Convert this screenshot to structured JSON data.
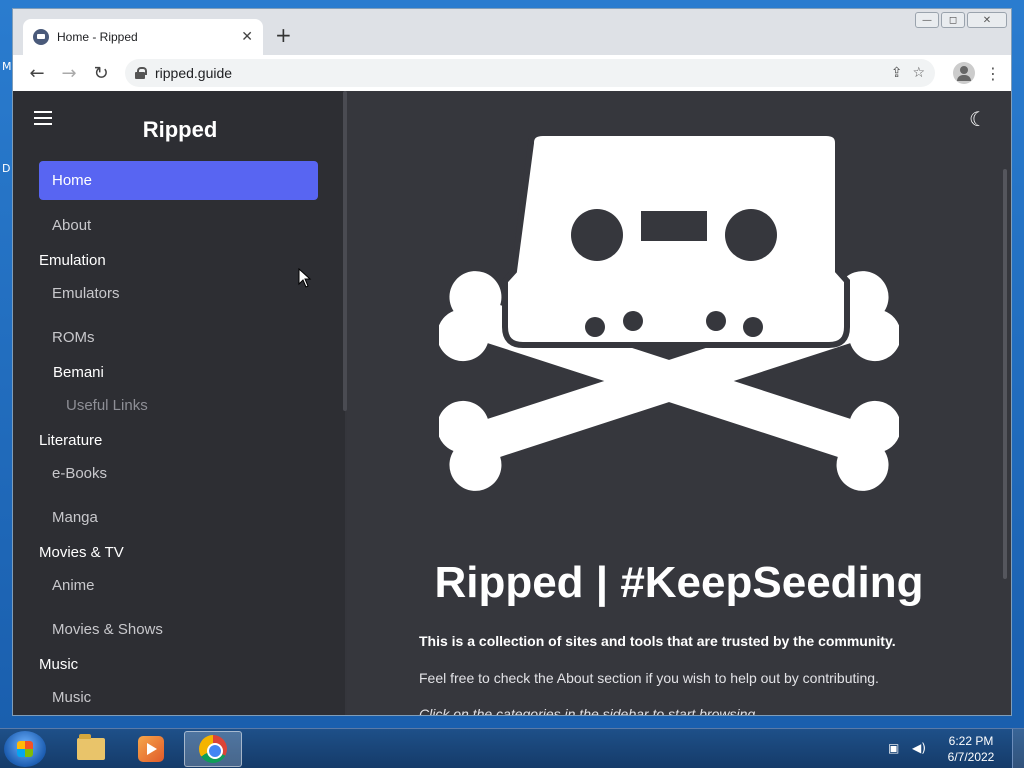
{
  "desktop": {
    "glyph_m": "M",
    "glyph_d": "D"
  },
  "browser": {
    "tab_title": "Home - Ripped",
    "tab_close": "✕",
    "new_tab": "+",
    "window_controls": {
      "minimize": "—",
      "maximize": "◻",
      "close": "✕"
    },
    "url": "ripped.guide",
    "back": "←",
    "forward": "→",
    "reload": "↻",
    "share": "⇪",
    "bookmark": "☆",
    "menu": "⋮"
  },
  "sidebar": {
    "brand": "Ripped",
    "items": [
      {
        "label": "Home",
        "kind": "active"
      },
      {
        "label": "About",
        "kind": "sub"
      },
      {
        "label": "Emulation",
        "kind": "cat"
      },
      {
        "label": "Emulators",
        "kind": "sub"
      },
      {
        "label": "ROMs",
        "kind": "sub"
      },
      {
        "label": "Bemani",
        "kind": "cat"
      },
      {
        "label": "Useful Links",
        "kind": "sub2"
      },
      {
        "label": "Literature",
        "kind": "cat"
      },
      {
        "label": "e-Books",
        "kind": "sub"
      },
      {
        "label": "Manga",
        "kind": "sub"
      },
      {
        "label": "Movies & TV",
        "kind": "cat"
      },
      {
        "label": "Anime",
        "kind": "sub"
      },
      {
        "label": "Movies & Shows",
        "kind": "sub"
      },
      {
        "label": "Music",
        "kind": "cat"
      },
      {
        "label": "Music",
        "kind": "sub"
      }
    ]
  },
  "main": {
    "title": "Ripped | #KeepSeeding",
    "lead": "This is a collection of sites and tools that are trusted by the community.",
    "body": "Feel free to check the About section if you wish to help out by contributing.",
    "hint": "Click on the categories in the sidebar to start browsing.",
    "theme_toggle": "☾"
  },
  "taskbar": {
    "time": "6:22 PM",
    "date": "6/7/2022"
  },
  "colors": {
    "accent": "#5865f2",
    "sidebar_bg": "#2d2e33",
    "main_bg": "#36373d"
  }
}
